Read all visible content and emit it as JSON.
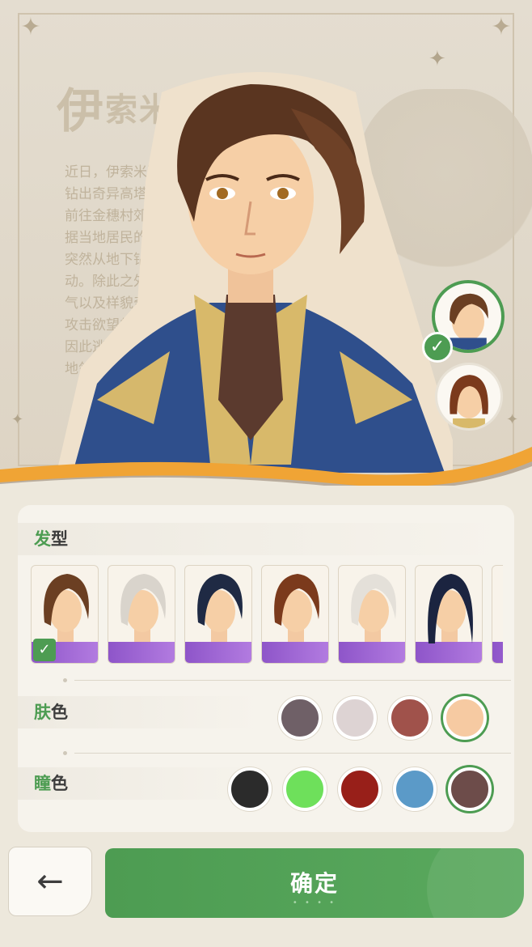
{
  "background": {
    "title_big": "伊",
    "title_rest": "索米",
    "paragraph_lines": [
      "近日，伊索米亚各",
      "钻出奇异高塔”",
      "前往金穗村郊外一",
      "据当地居民的描述，",
      "突然从地下钻出的，出",
      "动。除此之外，还出现",
      "气以及样貌奇异、对",
      "攻击欲望的怪物，",
      "因此逃离了世代居",
      "地领主尚未"
    ]
  },
  "hair_section": {
    "label_accent": "发",
    "label_rest": "型",
    "options": [
      {
        "name": "brown-swept",
        "color": "#6b3f22",
        "selected": true
      },
      {
        "name": "silver-swept",
        "color": "#d9d4cc",
        "selected": false
      },
      {
        "name": "navy-swept",
        "color": "#1f2a44",
        "selected": false
      },
      {
        "name": "auburn-swept",
        "color": "#7b3a1c",
        "selected": false
      },
      {
        "name": "white-swept",
        "color": "#e4e0d9",
        "selected": false
      },
      {
        "name": "navy-long",
        "color": "#1b2440",
        "selected": false
      }
    ]
  },
  "skin_section": {
    "label_accent": "肤",
    "label_rest": "色",
    "swatches": [
      {
        "color": "#6f6067",
        "selected": false
      },
      {
        "color": "#ddd3d3",
        "selected": false
      },
      {
        "color": "#a0524b",
        "selected": false
      },
      {
        "color": "#f6caa2",
        "selected": true
      }
    ]
  },
  "eye_section": {
    "label_accent": "瞳",
    "label_rest": "色",
    "swatches": [
      {
        "color": "#2b2b2b",
        "selected": false
      },
      {
        "color": "#6ee05b",
        "selected": false
      },
      {
        "color": "#981f19",
        "selected": false
      },
      {
        "color": "#5b9ac8",
        "selected": false
      },
      {
        "color": "#6d4c4a",
        "selected": true
      }
    ]
  },
  "character_avatars": [
    {
      "name": "male-avatar",
      "selected": true
    },
    {
      "name": "female-avatar",
      "selected": false
    }
  ],
  "buttons": {
    "back_icon": "←",
    "confirm_label": "确定"
  },
  "colors": {
    "accent_green": "#4d9c52",
    "panel_bg": "#f6f3ec",
    "hair_base_purple": "#9b63d4"
  }
}
